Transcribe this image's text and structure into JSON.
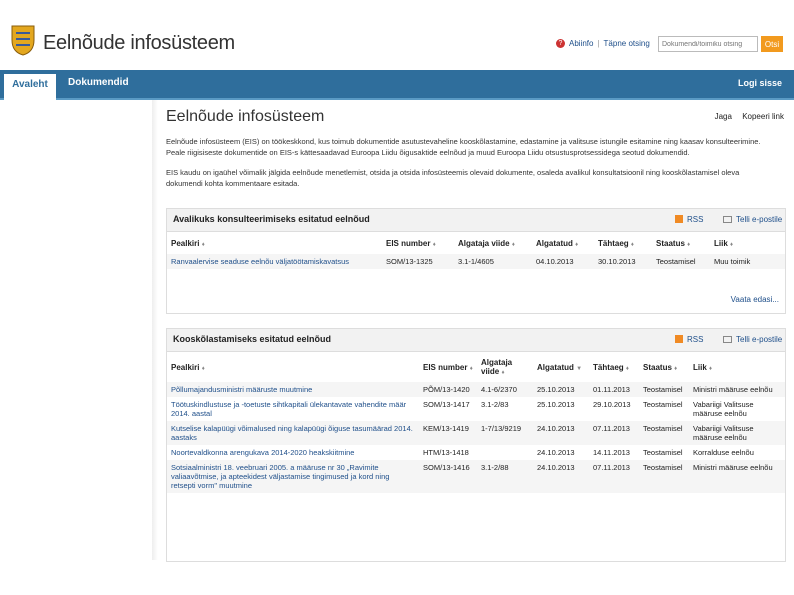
{
  "header": {
    "site_title": "Eelnõude infosüsteem",
    "help_label": "Abiinfo",
    "advanced_search_label": "Täpne otsing",
    "search_placeholder": "Dokumendi/toimiku otsing",
    "search_button": "Otsi"
  },
  "nav": {
    "tabs": [
      {
        "label": "Avaleht"
      },
      {
        "label": "Dokumendid"
      }
    ],
    "logout": "Logi sisse"
  },
  "main": {
    "title": "Eelnõude infosüsteem",
    "share": "Jaga",
    "copy_link": "Kopeeri link",
    "intro": [
      "Eelnõude infosüsteem (EIS) on töökeskkond, kus toimub dokumentide asutustevaheline kooskõlastamine, edastamine ja valitsuse istungile esitamine ning kaasav konsulteerimine. Peale riigisiseste dokumentide on EIS-s kättesaadavad Euroopa Liidu õigusaktide eelnõud ja muud Euroopa Liidu otsustusprotsessidega seotud dokumendid.",
      "EIS kaudu on igaühel võimalik jälgida eelnõude menetlemist, otsida ja otsida infosüsteemis olevaid dokumente, osaleda avalikul konsultatsioonil ning kooskõlastamisel oleva dokumendi kohta kommentaare esitada."
    ]
  },
  "consult": {
    "title": "Avalikuks konsulteerimiseks esitatud eelnõud",
    "rss": "RSS",
    "email": "Telli e-postile",
    "columns": [
      "Pealkiri",
      "EIS number",
      "Algataja viide",
      "Algatatud",
      "Tähtaeg",
      "Staatus",
      "Liik"
    ],
    "rows": [
      {
        "title": "Ranvaalervise seaduse eelnõu väljatöötamiskavatsus",
        "eis": "SOM/13-1325",
        "ref": "3.1-1/4605",
        "started": "04.10.2013",
        "deadline": "30.10.2013",
        "status": "Teostamisel",
        "type": "Muu toimik"
      }
    ],
    "more": "Vaata edasi..."
  },
  "approval": {
    "title": "Kooskõlastamiseks esitatud eelnõud",
    "rss": "RSS",
    "email": "Telli e-postile",
    "columns": [
      "Pealkiri",
      "EIS number",
      "Algataja viide",
      "Algatatud",
      "Tähtaeg",
      "Staatus",
      "Liik"
    ],
    "rows": [
      {
        "title": "Põllumajandusministri määruste muutmine",
        "eis": "PÕM/13-1420",
        "ref": "4.1-6/2370",
        "started": "25.10.2013",
        "deadline": "01.11.2013",
        "status": "Teostamisel",
        "type": "Ministri määruse eelnõu"
      },
      {
        "title": "Töötuskindlustuse ja -toetuste sihtkapitali ülekantavate vahendite määr 2014. aastal",
        "eis": "SOM/13-1417",
        "ref": "3.1-2/83",
        "started": "25.10.2013",
        "deadline": "29.10.2013",
        "status": "Teostamisel",
        "type": "Vabariigi Valitsuse määruse eelnõu"
      },
      {
        "title": "Kutselise kalapüügi võimalused ning kalapüügi õiguse tasumäärad 2014. aastaks",
        "eis": "KEM/13-1419",
        "ref": "1-7/13/9219",
        "started": "24.10.2013",
        "deadline": "07.11.2013",
        "status": "Teostamisel",
        "type": "Vabariigi Valitsuse määruse eelnõu"
      },
      {
        "title": "Noortevaldkonna arengukava 2014-2020 heakskiitmine",
        "eis": "HTM/13-1418",
        "ref": "",
        "started": "24.10.2013",
        "deadline": "14.11.2013",
        "status": "Teostamisel",
        "type": "Korralduse eelnõu"
      },
      {
        "title": "Sotsiaalministri 18. veebruari 2005. a määruse nr 30 „Ravimite valiaavõtmise, ja apteekidest väljastamise tingimused ja kord ning retsepti vorm\" muutmine",
        "eis": "SOM/13-1416",
        "ref": "3.1-2/88",
        "started": "24.10.2013",
        "deadline": "07.11.2013",
        "status": "Teostamisel",
        "type": "Ministri määruse eelnõu"
      }
    ]
  }
}
